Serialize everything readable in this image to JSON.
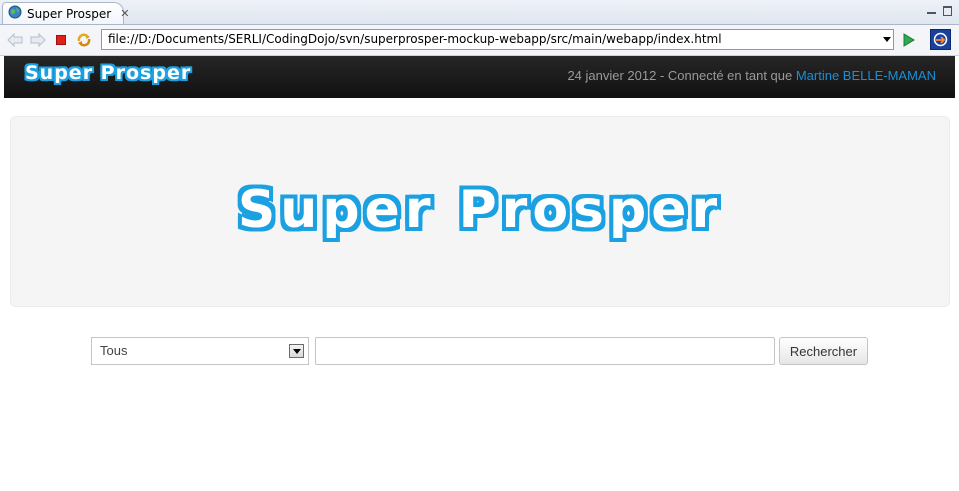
{
  "browser": {
    "tab_title": "Super Prosper",
    "url": "file://D:/Documents/SERLI/CodingDojo/svn/superprosper-mockup-webapp/src/main/webapp/index.html",
    "icons": {
      "tab": "globe-icon",
      "close": "close-icon",
      "back": "back-arrow-icon",
      "forward": "forward-arrow-icon",
      "stop": "stop-icon",
      "refresh": "refresh-icon",
      "go": "go-icon",
      "external": "external-browser-icon",
      "minimize": "minimize-icon",
      "maximize": "maximize-icon"
    }
  },
  "header": {
    "brand": "Super Prosper",
    "date": "24 janvier 2012",
    "connected_prefix": " - Connecté en tant que ",
    "user_name": "Martine BELLE-MAMAN"
  },
  "hero": {
    "logo_text": "Super Prosper"
  },
  "search": {
    "category_selected": "Tous",
    "query_value": "",
    "button_label": "Rechercher"
  },
  "colors": {
    "brand_blue": "#1ba1e2",
    "user_link": "#1a8fd8",
    "topbar": "#1a1a1a",
    "hero_bg": "#f5f5f5"
  }
}
